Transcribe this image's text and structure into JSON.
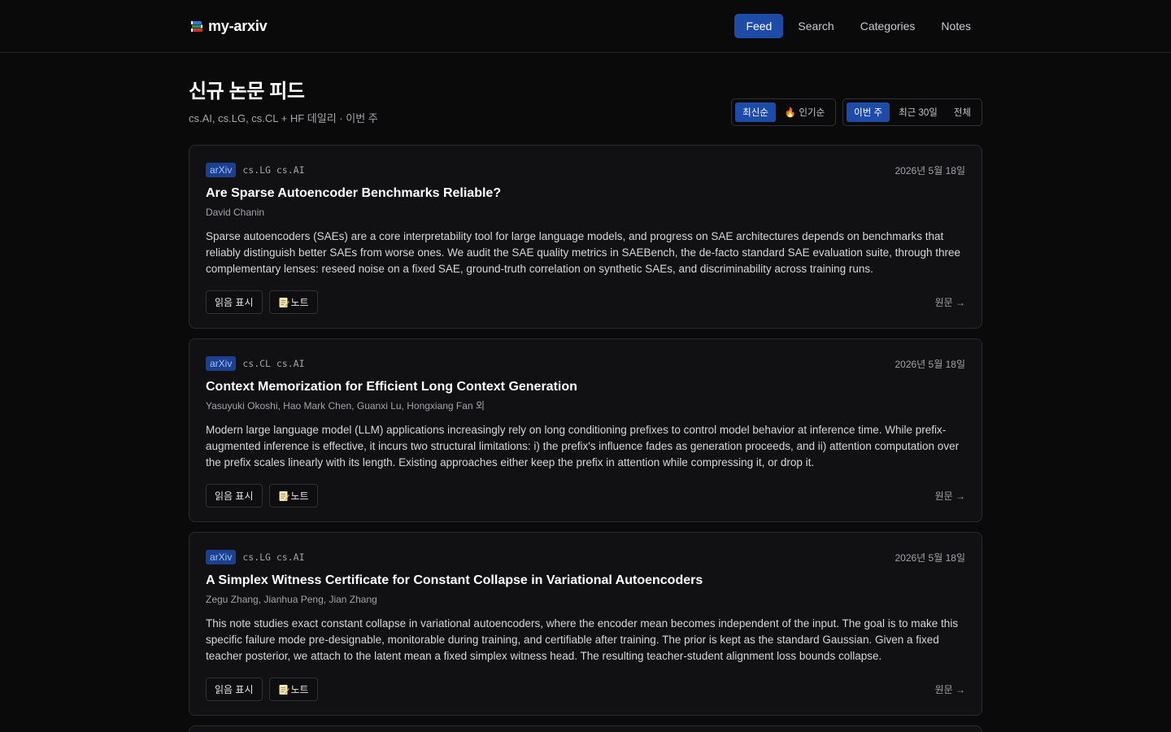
{
  "app": {
    "brand_name": "my-arxiv",
    "brand_icon": "books-icon"
  },
  "nav": {
    "items": [
      {
        "label": "Feed",
        "active": true
      },
      {
        "label": "Search",
        "active": false
      },
      {
        "label": "Categories",
        "active": false
      },
      {
        "label": "Notes",
        "active": false
      }
    ]
  },
  "header": {
    "title": "신규 논문 피드",
    "subtitle": "cs.AI, cs.LG, cs.CL + HF 데일리 · 이번 주"
  },
  "sort": {
    "options": [
      {
        "label": "최신순",
        "active": true
      },
      {
        "label": "🔥 인기순",
        "active": false
      }
    ]
  },
  "period": {
    "options": [
      {
        "label": "이번 주",
        "active": true
      },
      {
        "label": "최근 30일",
        "active": false
      },
      {
        "label": "전체",
        "active": false
      }
    ]
  },
  "card_actions": {
    "mark_read": "읽음 표시",
    "note": "노트",
    "original": "원문 →"
  },
  "papers": [
    {
      "source": "arXiv",
      "categories": "cs.LG  cs.AI",
      "date": "2026년 5월 18일",
      "title": "Are Sparse Autoencoder Benchmarks Reliable?",
      "authors": "David Chanin",
      "abstract": "Sparse autoencoders (SAEs) are a core interpretability tool for large language models, and progress on SAE architectures depends on benchmarks that reliably distinguish better SAEs from worse ones. We audit the SAE quality metrics in SAEBench, the de-facto standard SAE evaluation suite, through three complementary lenses: reseed noise on a fixed SAE, ground-truth correlation on synthetic SAEs, and discriminability across training runs."
    },
    {
      "source": "arXiv",
      "categories": "cs.CL  cs.AI",
      "date": "2026년 5월 18일",
      "title": "Context Memorization for Efficient Long Context Generation",
      "authors": "Yasuyuki Okoshi, Hao Mark Chen, Guanxi Lu, Hongxiang Fan 외",
      "abstract": "Modern large language model (LLM) applications increasingly rely on long conditioning prefixes to control model behavior at inference time. While prefix-augmented inference is effective, it incurs two structural limitations: i) the prefix's influence fades as generation proceeds, and ii) attention computation over the prefix scales linearly with its length. Existing approaches either keep the prefix in attention while compressing it, or drop it."
    },
    {
      "source": "arXiv",
      "categories": "cs.LG  cs.AI",
      "date": "2026년 5월 18일",
      "title": "A Simplex Witness Certificate for Constant Collapse in Variational Autoencoders",
      "authors": "Zegu Zhang, Jianhua Peng, Jian Zhang",
      "abstract": "This note studies exact constant collapse in variational autoencoders, where the encoder mean becomes independent of the input. The goal is to make this specific failure mode pre-designable, monitorable during training, and certifiable after training. The prior is kept as the standard Gaussian. Given a fixed teacher posterior, we attach to the latent mean a fixed simplex witness head. The resulting teacher-student alignment loss bounds collapse."
    }
  ],
  "colors": {
    "background": "#0a0a0b",
    "card": "#111113",
    "accent": "#1f4ba8",
    "badge_text": "#9ec0ff"
  }
}
